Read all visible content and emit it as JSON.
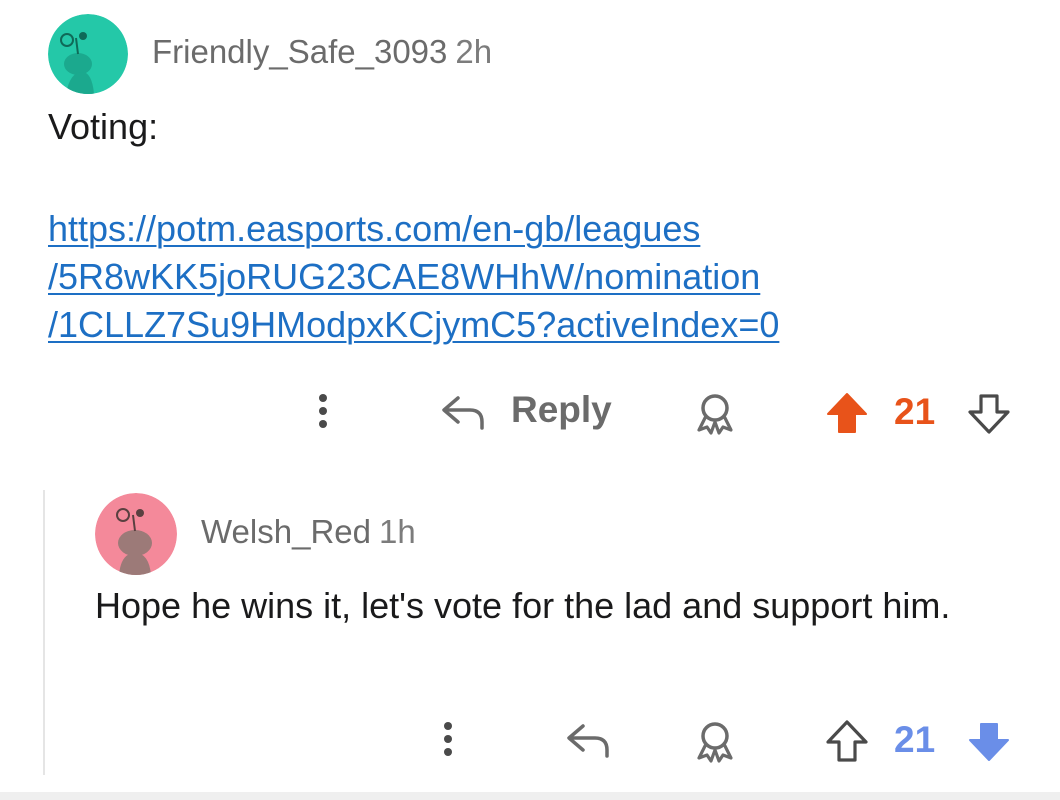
{
  "comments": [
    {
      "author": "Friendly_Safe_3093",
      "age": "2h",
      "avatar_color": "#24c8a8",
      "text": "Voting:",
      "link_lines": [
        "https://potm.easports.com/en-gb/leagues",
        "/5R8wKK5joRUG23CAE8WHhW/nomination",
        "/1CLLZ7Su9HModpxKCjymC5?activeIndex=0"
      ],
      "actions": {
        "more_icon": "more-vertical-icon",
        "reply_icon": "reply-arrow-icon",
        "reply_label": "Reply",
        "award_icon": "award-icon",
        "vote_count": "21",
        "vote_state": "upvoted",
        "upvote_color": "#e8531a"
      }
    },
    {
      "author": "Welsh_Red",
      "age": "1h",
      "avatar_color": "#f4899a",
      "text": "Hope he wins it, let's vote for the lad and support him.",
      "actions": {
        "more_icon": "more-vertical-icon",
        "reply_icon": "reply-arrow-icon",
        "award_icon": "award-icon",
        "vote_count": "21",
        "vote_state": "downvoted",
        "downvote_color": "#6a8ee8"
      }
    }
  ]
}
